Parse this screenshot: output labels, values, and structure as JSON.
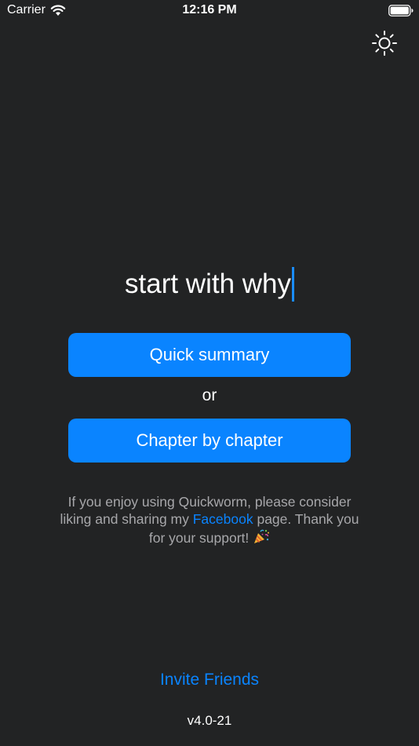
{
  "status_bar": {
    "carrier": "Carrier",
    "time": "12:16 PM"
  },
  "icons": {
    "wifi": "wifi-icon",
    "battery": "battery-icon",
    "theme_toggle": "sun-icon",
    "celebration": "party-popper-icon"
  },
  "search": {
    "value": "start with why"
  },
  "actions": {
    "quick_summary_label": "Quick summary",
    "separator": "or",
    "chapter_label": "Chapter by chapter"
  },
  "support_message": {
    "before_link": "If you enjoy using Quickworm, please consider liking and sharing my ",
    "link_text": "Facebook",
    "after_link": " page. Thank you for your support! "
  },
  "footer": {
    "invite_label": "Invite Friends",
    "version": "v4.0-21"
  },
  "colors": {
    "background": "#222324",
    "accent": "#0a84ff",
    "secondary_text": "#a7a7aa"
  }
}
